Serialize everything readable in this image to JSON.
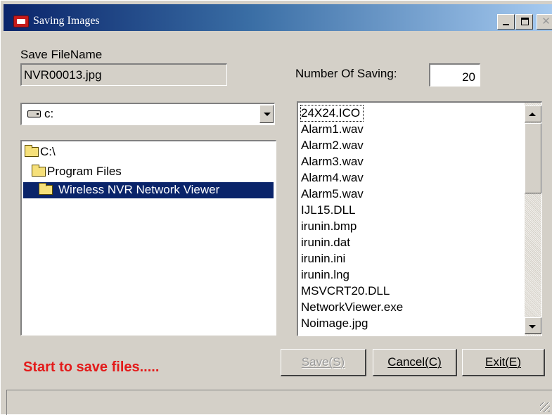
{
  "window": {
    "title": "Saving Images",
    "min_glyph": "",
    "max_glyph": "",
    "close_glyph": "✕"
  },
  "save_filename": {
    "label": "Save FileName",
    "value": "NVR00013.jpg"
  },
  "number_of_saving": {
    "label": "Number Of Saving:",
    "value": "20"
  },
  "drive": {
    "selected": "c:",
    "icon": "drive-icon"
  },
  "folder_tree": [
    {
      "label": "C:\\",
      "selected": false,
      "icon": "open-folder-icon"
    },
    {
      "label": "Program Files",
      "selected": false,
      "icon": "open-folder-icon"
    },
    {
      "label": "Wireless NVR Network Viewer",
      "selected": true,
      "icon": "open-folder-icon"
    }
  ],
  "file_list": [
    "24X24.ICO",
    "Alarm1.wav",
    "Alarm2.wav",
    "Alarm3.wav",
    "Alarm4.wav",
    "Alarm5.wav",
    "IJL15.DLL",
    "irunin.bmp",
    "irunin.dat",
    "irunin.ini",
    "irunin.lng",
    "MSVCRT20.DLL",
    "NetworkViewer.exe",
    "Noimage.jpg"
  ],
  "buttons": {
    "save": "Save(S)",
    "cancel": "Cancel(C)",
    "exit": "Exit(E)"
  },
  "status_message": "Start to save files.....",
  "colors": {
    "title_bar_start": "#0a246a",
    "title_bar_end": "#a6caf0",
    "selection": "#0a246a",
    "status_message": "#e31b1b",
    "window_bg": "#d4d0c8"
  }
}
